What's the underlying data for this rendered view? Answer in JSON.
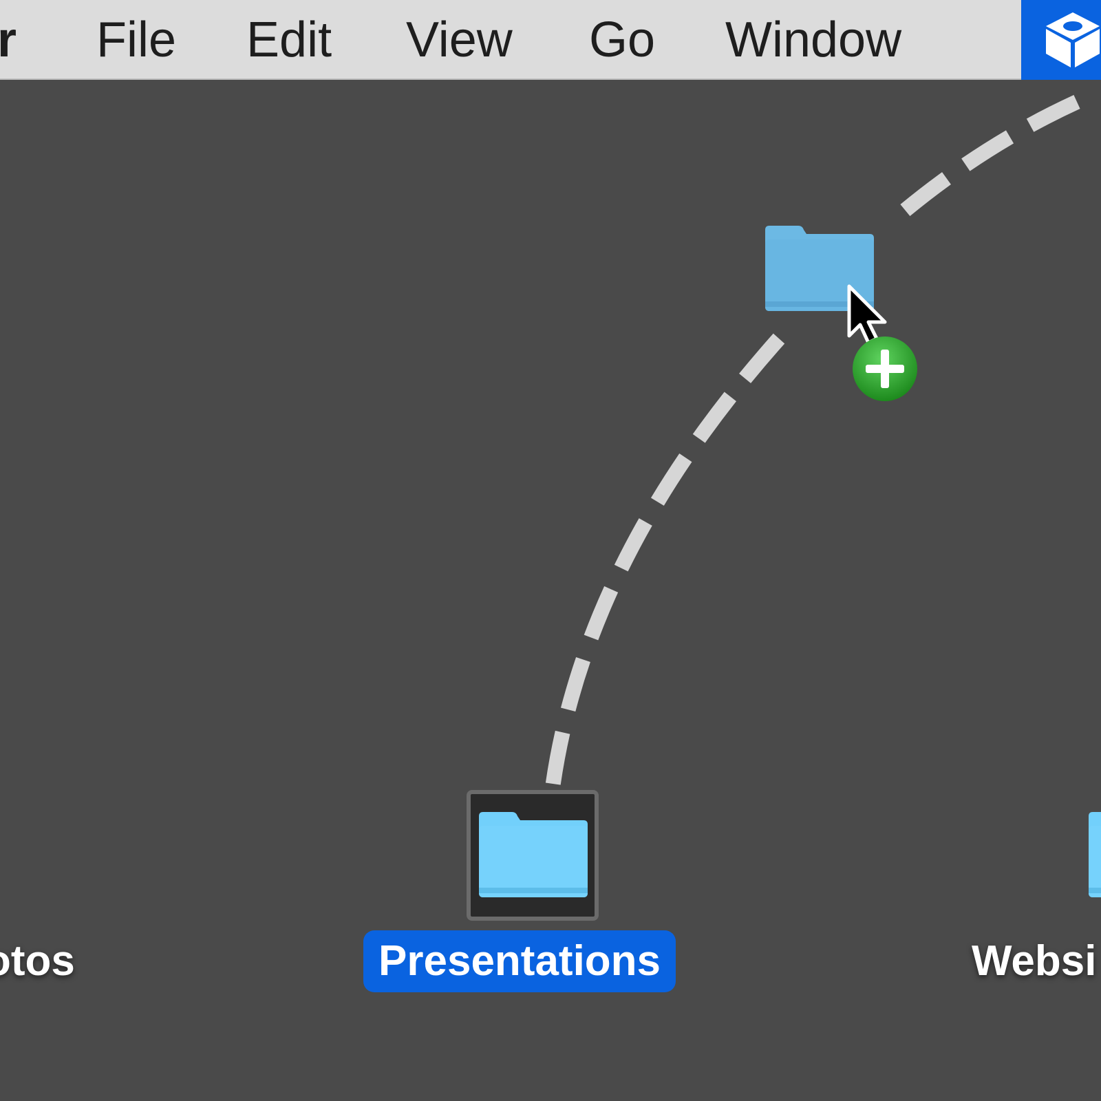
{
  "menubar": {
    "app_name": "er",
    "items": [
      "File",
      "Edit",
      "View",
      "Go",
      "Window"
    ]
  },
  "desktop": {
    "icons": [
      {
        "label": "otos",
        "selected": false
      },
      {
        "label": "Presentations",
        "selected": true
      },
      {
        "label": "Websi",
        "selected": false
      }
    ]
  },
  "colors": {
    "menubar_bg": "#dcdcdc",
    "desktop_bg": "#4a4a4a",
    "selection_blue": "#0a63e0",
    "folder_blue": "#72d0fb",
    "badge_green": "#2aa52a"
  },
  "icons": {
    "folder": "folder-icon",
    "cursor": "arrow-cursor-icon",
    "copy_badge": "plus-badge-icon",
    "menu_extra": "box-3d-icon"
  }
}
